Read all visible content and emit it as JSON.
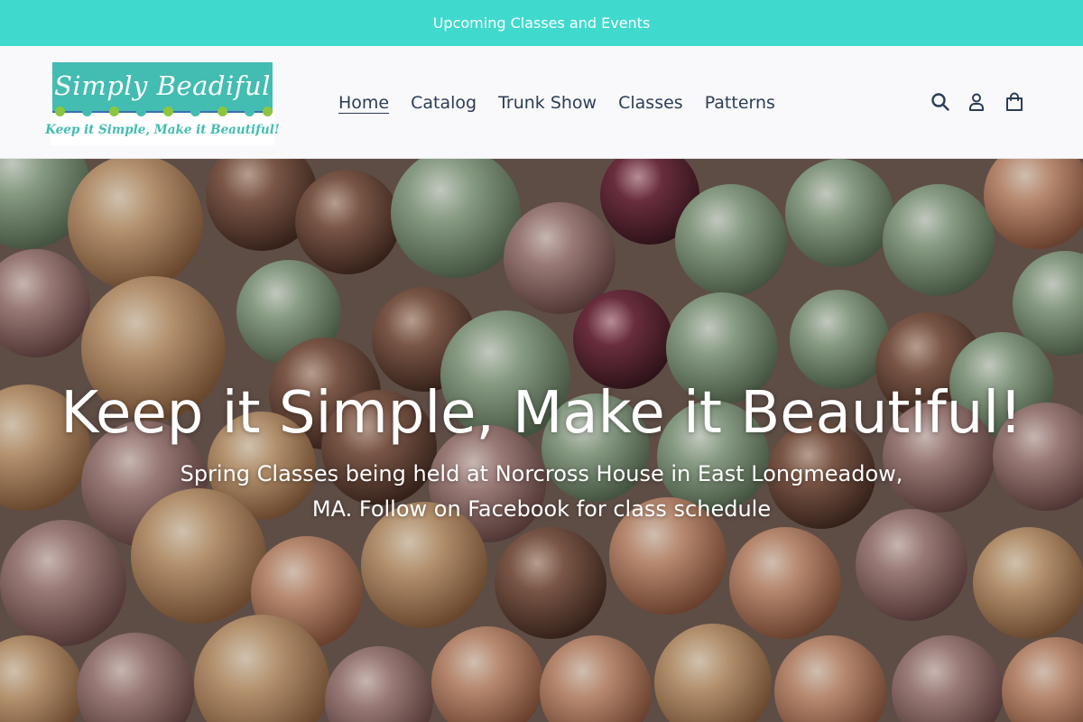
{
  "announcement": {
    "text": "Upcoming Classes and Events"
  },
  "logo": {
    "title": "Simply Beadiful",
    "tagline": "Keep it Simple, Make it Beautiful!"
  },
  "nav": {
    "items": [
      {
        "label": "Home",
        "active": true
      },
      {
        "label": "Catalog",
        "active": false
      },
      {
        "label": "Trunk Show",
        "active": false
      },
      {
        "label": "Classes",
        "active": false
      },
      {
        "label": "Patterns",
        "active": false
      }
    ]
  },
  "header_icons": [
    "search-icon",
    "account-icon",
    "cart-icon"
  ],
  "hero": {
    "title": "Keep it Simple, Make it Beautiful!",
    "subtitle": "Spring Classes being held at Norcross House in East Longmeadow, MA. Follow on Facebook for class schedule"
  },
  "colors": {
    "announcement_bg": "#3fdacd",
    "header_bg": "#f9f9fb",
    "nav_text": "#2c3c55",
    "logo_teal": "#43bcb1",
    "logo_green_dot": "#8cc63f",
    "logo_teal_dot": "#43bcb1"
  }
}
